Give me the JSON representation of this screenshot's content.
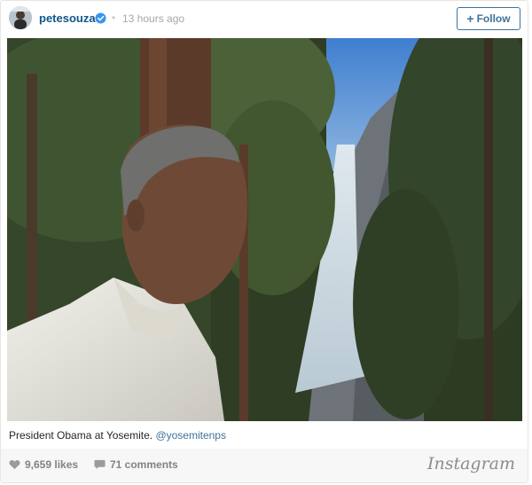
{
  "post": {
    "username": "petesouza",
    "separator": "•",
    "time": "13 hours ago",
    "follow_label": "Follow",
    "follow_plus": "+",
    "caption_text": "President Obama at Yosemite. ",
    "caption_mention": "@yosemitenps",
    "likes": "9,659 likes",
    "comments": "71 comments",
    "logo_text": "Instagram"
  },
  "colors": {
    "username": "#125688",
    "link": "#3f729b",
    "verified_badge": "#3897f0",
    "meta": "#a5a7aa",
    "footer_bg": "#f7f7f7"
  },
  "icons": {
    "verified": "verified-badge-icon",
    "likes": "heart-icon",
    "comments": "speech-bubble-icon"
  }
}
